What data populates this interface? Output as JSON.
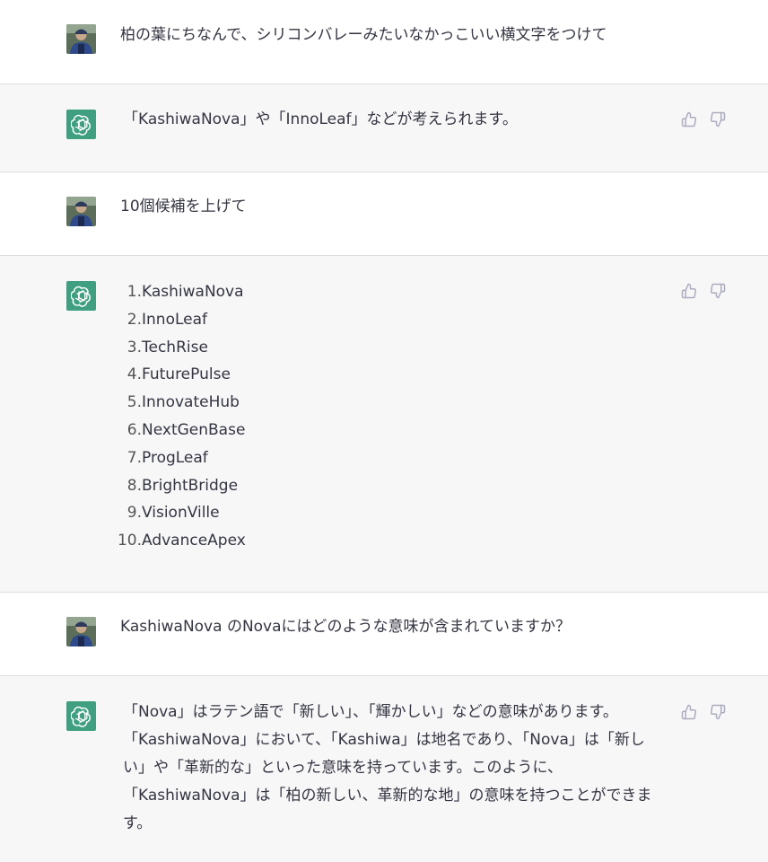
{
  "messages": [
    {
      "role": "user",
      "text": "柏の葉にちなんで、シリコンバレーみたいなかっこいい横文字をつけて"
    },
    {
      "role": "assistant",
      "text": "「KashiwaNova」や「InnoLeaf」などが考えられます。"
    },
    {
      "role": "user",
      "text": "10個候補を上げて"
    },
    {
      "role": "assistant",
      "list": [
        {
          "num": "1.",
          "label": "KashiwaNova"
        },
        {
          "num": "2.",
          "label": "InnoLeaf"
        },
        {
          "num": "3.",
          "label": "TechRise"
        },
        {
          "num": "4.",
          "label": "FuturePulse"
        },
        {
          "num": "5.",
          "label": "InnovateHub"
        },
        {
          "num": "6.",
          "label": "NextGenBase"
        },
        {
          "num": "7.",
          "label": "ProgLeaf"
        },
        {
          "num": "8.",
          "label": "BrightBridge"
        },
        {
          "num": "9.",
          "label": "VisionVille"
        },
        {
          "num": "10.",
          "label": "AdvanceApex"
        }
      ]
    },
    {
      "role": "user",
      "text": "KashiwaNova のNovaにはどのような意味が含まれていますか？"
    },
    {
      "role": "assistant",
      "lines": [
        "「Nova」はラテン語で「新しい」、「輝かしい」などの意味があります。",
        "「KashiwaNova」において、「Kashiwa」は地名であり、「Nova」は「新し",
        "い」や「革新的な」といった意味を持っています。このように、",
        "「KashiwaNova」は「柏の新しい、革新的な地」の意味を持つことができま",
        "す。"
      ]
    }
  ],
  "icons": {
    "user_avatar": "user-photo-avatar",
    "assistant_avatar": "openai-logo-icon",
    "like": "thumbs-up-icon",
    "dislike": "thumbs-down-icon"
  },
  "colors": {
    "assistant_bg": "#f7f7f8",
    "user_bg": "#ffffff",
    "avatar_green": "#3f9f80",
    "text": "#343541",
    "icon": "#acacbe"
  }
}
